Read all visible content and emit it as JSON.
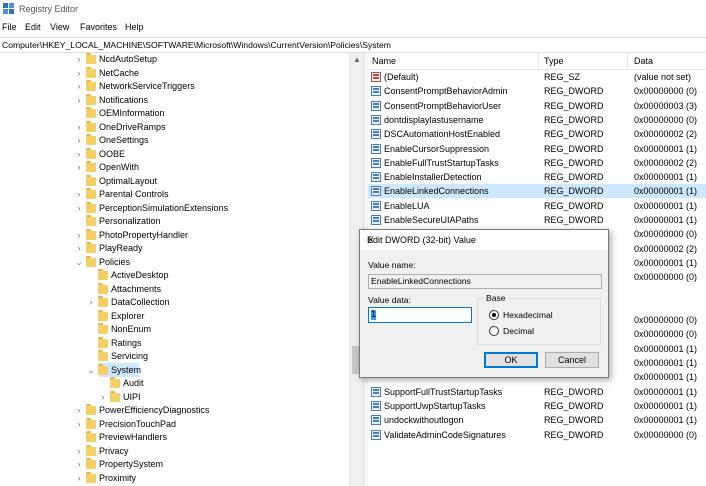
{
  "window": {
    "title": "Registry Editor",
    "icon": "registry-editor-icon"
  },
  "menu": [
    "File",
    "Edit",
    "View",
    "Favorites",
    "Help"
  ],
  "address": "Computer\\HKEY_LOCAL_MACHINE\\SOFTWARE\\Microsoft\\Windows\\CurrentVersion\\Policies\\System",
  "tree": [
    {
      "label": "NcdAutoSetup",
      "expander": "›"
    },
    {
      "label": "NetCache",
      "expander": "›"
    },
    {
      "label": "NetworkServiceTriggers",
      "expander": "›"
    },
    {
      "label": "Notifications",
      "expander": "›"
    },
    {
      "label": "OEMInformation",
      "expander": ""
    },
    {
      "label": "OneDriveRamps",
      "expander": "›"
    },
    {
      "label": "OneSettings",
      "expander": "›"
    },
    {
      "label": "OOBE",
      "expander": "›"
    },
    {
      "label": "OpenWith",
      "expander": "›"
    },
    {
      "label": "OptimalLayout",
      "expander": ""
    },
    {
      "label": "Parental Controls",
      "expander": "›"
    },
    {
      "label": "PerceptionSimulationExtensions",
      "expander": "›"
    },
    {
      "label": "Personalization",
      "expander": ""
    },
    {
      "label": "PhotoPropertyHandler",
      "expander": "›"
    },
    {
      "label": "PlayReady",
      "expander": "›"
    },
    {
      "label": "Policies",
      "expander": "⌄"
    },
    {
      "label": "ActiveDesktop",
      "expander": ""
    },
    {
      "label": "Attachments",
      "expander": ""
    },
    {
      "label": "DataCollection",
      "expander": "›"
    },
    {
      "label": "Explorer",
      "expander": ""
    },
    {
      "label": "NonEnum",
      "expander": ""
    },
    {
      "label": "Ratings",
      "expander": ""
    },
    {
      "label": "Servicing",
      "expander": ""
    },
    {
      "label": "System",
      "expander": "⌄",
      "selected": true
    },
    {
      "label": "Audit",
      "expander": ""
    },
    {
      "label": "UIPI",
      "expander": "›"
    },
    {
      "label": "PowerEfficiencyDiagnostics",
      "expander": "›"
    },
    {
      "label": "PrecisionTouchPad",
      "expander": "›"
    },
    {
      "label": "PreviewHandlers",
      "expander": ""
    },
    {
      "label": "Privacy",
      "expander": "›"
    },
    {
      "label": "PropertySystem",
      "expander": "›"
    },
    {
      "label": "Proximity",
      "expander": "›"
    }
  ],
  "columns": {
    "name": "Name",
    "type": "Type",
    "data": "Data"
  },
  "values": [
    {
      "name": "(Default)",
      "type": "REG_SZ",
      "data": "(value not set)",
      "icon": "string"
    },
    {
      "name": "ConsentPromptBehaviorAdmin",
      "type": "REG_DWORD",
      "data": "0x00000000 (0)",
      "icon": "dword"
    },
    {
      "name": "ConsentPromptBehaviorUser",
      "type": "REG_DWORD",
      "data": "0x00000003 (3)",
      "icon": "dword"
    },
    {
      "name": "dontdisplaylastusername",
      "type": "REG_DWORD",
      "data": "0x00000000 (0)",
      "icon": "dword"
    },
    {
      "name": "DSCAutomationHostEnabled",
      "type": "REG_DWORD",
      "data": "0x00000002 (2)",
      "icon": "dword"
    },
    {
      "name": "EnableCursorSuppression",
      "type": "REG_DWORD",
      "data": "0x00000001 (1)",
      "icon": "dword"
    },
    {
      "name": "EnableFullTrustStartupTasks",
      "type": "REG_DWORD",
      "data": "0x00000002 (2)",
      "icon": "dword"
    },
    {
      "name": "EnableInstallerDetection",
      "type": "REG_DWORD",
      "data": "0x00000001 (1)",
      "icon": "dword"
    },
    {
      "name": "EnableLinkedConnections",
      "type": "REG_DWORD",
      "data": "0x00000001 (1)",
      "icon": "dword",
      "selected": true
    },
    {
      "name": "EnableLUA",
      "type": "REG_DWORD",
      "data": "0x00000001 (1)",
      "icon": "dword"
    },
    {
      "name": "EnableSecureUIAPaths",
      "type": "REG_DWORD",
      "data": "0x00000001 (1)",
      "icon": "dword"
    },
    {
      "name": "",
      "type": "",
      "data": "0x00000000 (0)",
      "icon": ""
    },
    {
      "name": "",
      "type": "",
      "data": "0x00000002 (2)",
      "icon": ""
    },
    {
      "name": "",
      "type": "",
      "data": "0x00000001 (1)",
      "icon": ""
    },
    {
      "name": "",
      "type": "",
      "data": "0x00000000 (0)",
      "icon": ""
    },
    {
      "name": "",
      "type": "",
      "data": "",
      "icon": ""
    },
    {
      "name": "",
      "type": "",
      "data": "",
      "icon": ""
    },
    {
      "name": "",
      "type": "",
      "data": "0x00000000 (0)",
      "icon": ""
    },
    {
      "name": "",
      "type": "",
      "data": "0x00000000 (0)",
      "icon": ""
    },
    {
      "name": "",
      "type": "",
      "data": "0x00000001 (1)",
      "icon": ""
    },
    {
      "name": "",
      "type": "",
      "data": "0x00000001 (1)",
      "icon": ""
    },
    {
      "name": "",
      "type": "",
      "data": "0x00000001 (1)",
      "icon": ""
    },
    {
      "name": "SupportFullTrustStartupTasks",
      "type": "REG_DWORD",
      "data": "0x00000001 (1)",
      "icon": "dword"
    },
    {
      "name": "SupportUwpStartupTasks",
      "type": "REG_DWORD",
      "data": "0x00000001 (1)",
      "icon": "dword"
    },
    {
      "name": "undockwithoutlogon",
      "type": "REG_DWORD",
      "data": "0x00000001 (1)",
      "icon": "dword"
    },
    {
      "name": "ValidateAdminCodeSignatures",
      "type": "REG_DWORD",
      "data": "0x00000000 (0)",
      "icon": "dword"
    }
  ],
  "dialog": {
    "title": "Edit DWORD (32-bit) Value",
    "value_name_label": "Value name:",
    "value_name": "EnableLinkedConnections",
    "value_data_label": "Value data:",
    "value_data": "1",
    "base_label": "Base",
    "hex_label": "Hexadecimal",
    "dec_label": "Decimal",
    "base_selected": "Hexadecimal",
    "ok_label": "OK",
    "cancel_label": "Cancel"
  }
}
